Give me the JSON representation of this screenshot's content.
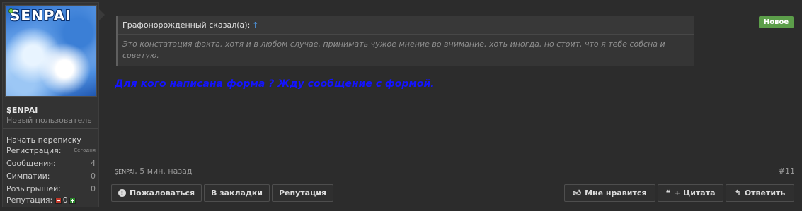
{
  "user": {
    "avatar_text": "SENPAI",
    "name": "ŞENPAI",
    "title": "Новый пользователь",
    "start_conversation": "Начать переписку",
    "stats": [
      {
        "label": "Регистрация:",
        "value": "Сегодня"
      },
      {
        "label": "Сообщения:",
        "value": "4"
      },
      {
        "label": "Симпатии:",
        "value": "0"
      },
      {
        "label": "Розыгрышей:",
        "value": "0"
      }
    ],
    "reputation_label": "Репутация:",
    "reputation_value": "0"
  },
  "post": {
    "badge": "Новое",
    "quote_author": "Графонорожденный сказал(а):",
    "quote_arrow": "↑",
    "quote_text": "Это констатация факта, хотя и в любом случае, принимать чужое мнение во внимание, хоть иногда, но стоит, что я тебе собсна и советую.",
    "message": "Для кого написана форма ? Жду сообщение с формой.",
    "author": "şenpai",
    "time": ", 5 мин. назад",
    "number": "#11"
  },
  "actions": {
    "report": "Пожаловаться",
    "bookmark": "В закладки",
    "reputation": "Репутация",
    "like": "Мне нравится",
    "quote": "+ Цитата",
    "reply": "Ответить"
  },
  "colors": {
    "message": "#1414ff",
    "badge": "#5c9e4a",
    "quote_arrow": "#4f9be8"
  }
}
